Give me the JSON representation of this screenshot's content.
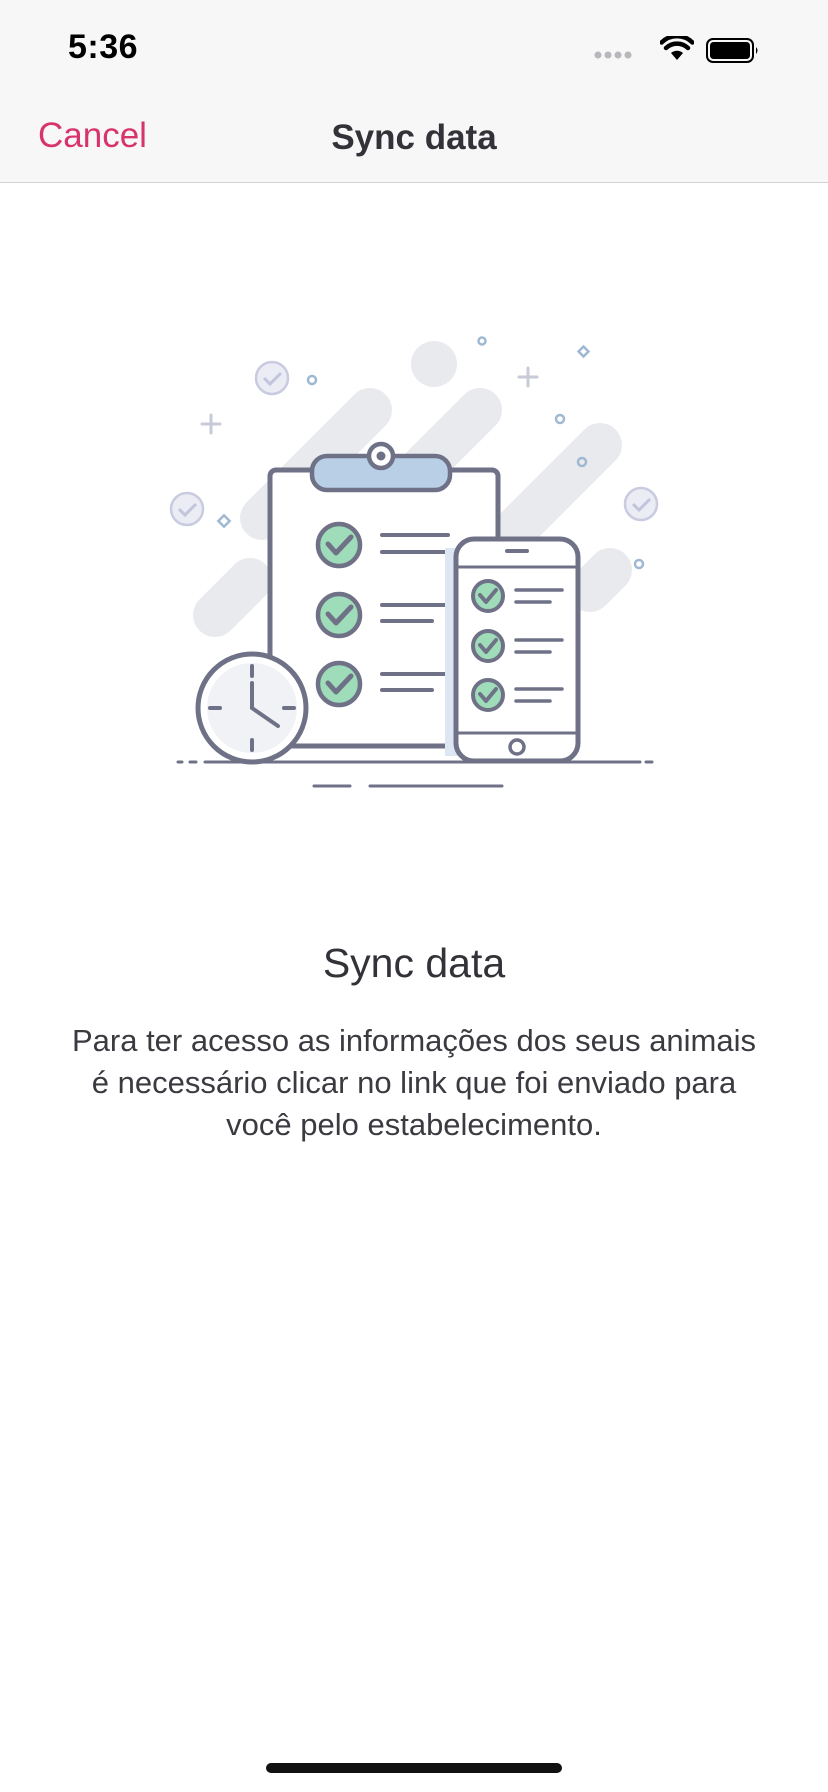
{
  "status_bar": {
    "time": "5:36",
    "icons": [
      "signal-icon",
      "wifi-icon",
      "battery-icon"
    ]
  },
  "nav": {
    "cancel_label": "Cancel",
    "title": "Sync data"
  },
  "content": {
    "illustration": "sync-illustration-icon",
    "title": "Sync data",
    "body": "Para ter acesso as informações dos seus animais é necessário clicar no link que foi enviado para você pelo estabelecimento."
  },
  "colors": {
    "accent": "#d8336d",
    "nav_background": "#f7f7f7",
    "text_primary": "#333238",
    "illustration_stroke": "#6f7287",
    "check_fill": "#9fdcb9",
    "clip_fill": "#b8cfe6"
  }
}
